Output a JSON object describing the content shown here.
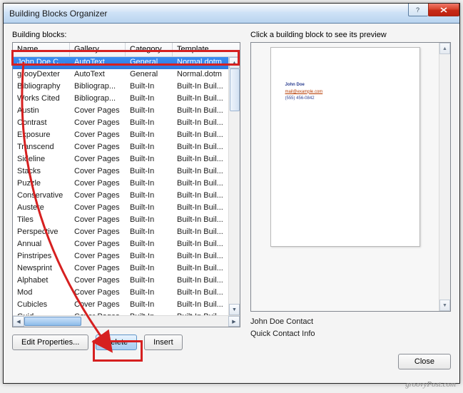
{
  "titlebar": {
    "title": "Building Blocks Organizer"
  },
  "left_label": "Building blocks:",
  "right_label": "Click a building block to see its preview",
  "columns": {
    "name": "Name",
    "gallery": "Gallery",
    "category": "Category",
    "template": "Template"
  },
  "rows": [
    {
      "name": "John Doe C...",
      "gallery": "AutoText",
      "category": "General",
      "template": "Normal.dotm",
      "selected": true
    },
    {
      "name": "grooyDexter",
      "gallery": "AutoText",
      "category": "General",
      "template": "Normal.dotm"
    },
    {
      "name": "Bibliography",
      "gallery": "Bibliograp...",
      "category": "Built-In",
      "template": "Built-In Buil..."
    },
    {
      "name": "Works Cited",
      "gallery": "Bibliograp...",
      "category": "Built-In",
      "template": "Built-In Buil..."
    },
    {
      "name": "Austin",
      "gallery": "Cover Pages",
      "category": "Built-In",
      "template": "Built-In Buil..."
    },
    {
      "name": "Contrast",
      "gallery": "Cover Pages",
      "category": "Built-In",
      "template": "Built-In Buil..."
    },
    {
      "name": "Exposure",
      "gallery": "Cover Pages",
      "category": "Built-In",
      "template": "Built-In Buil..."
    },
    {
      "name": "Transcend",
      "gallery": "Cover Pages",
      "category": "Built-In",
      "template": "Built-In Buil..."
    },
    {
      "name": "Sideline",
      "gallery": "Cover Pages",
      "category": "Built-In",
      "template": "Built-In Buil..."
    },
    {
      "name": "Stacks",
      "gallery": "Cover Pages",
      "category": "Built-In",
      "template": "Built-In Buil..."
    },
    {
      "name": "Puzzle",
      "gallery": "Cover Pages",
      "category": "Built-In",
      "template": "Built-In Buil..."
    },
    {
      "name": "Conservative",
      "gallery": "Cover Pages",
      "category": "Built-In",
      "template": "Built-In Buil..."
    },
    {
      "name": "Austere",
      "gallery": "Cover Pages",
      "category": "Built-In",
      "template": "Built-In Buil..."
    },
    {
      "name": "Tiles",
      "gallery": "Cover Pages",
      "category": "Built-In",
      "template": "Built-In Buil..."
    },
    {
      "name": "Perspective",
      "gallery": "Cover Pages",
      "category": "Built-In",
      "template": "Built-In Buil..."
    },
    {
      "name": "Annual",
      "gallery": "Cover Pages",
      "category": "Built-In",
      "template": "Built-In Buil..."
    },
    {
      "name": "Pinstripes",
      "gallery": "Cover Pages",
      "category": "Built-In",
      "template": "Built-In Buil..."
    },
    {
      "name": "Newsprint",
      "gallery": "Cover Pages",
      "category": "Built-In",
      "template": "Built-In Buil..."
    },
    {
      "name": "Alphabet",
      "gallery": "Cover Pages",
      "category": "Built-In",
      "template": "Built-In Buil..."
    },
    {
      "name": "Mod",
      "gallery": "Cover Pages",
      "category": "Built-In",
      "template": "Built-In Buil..."
    },
    {
      "name": "Cubicles",
      "gallery": "Cover Pages",
      "category": "Built-In",
      "template": "Built-In Buil..."
    },
    {
      "name": "Guid",
      "gallery": "Cover Pages",
      "category": "Built-In",
      "template": "Built-In Buil"
    }
  ],
  "buttons": {
    "edit_properties": "Edit Properties...",
    "delete": "Delete",
    "insert": "Insert",
    "close": "Close"
  },
  "preview": {
    "name_line": "John Doe",
    "email_line": "mail@example.com",
    "phone_line": "(555) 456-0842",
    "label1": "John Doe Contact",
    "label2": "Quick Contact Info"
  },
  "watermark": "groovyPost.com"
}
